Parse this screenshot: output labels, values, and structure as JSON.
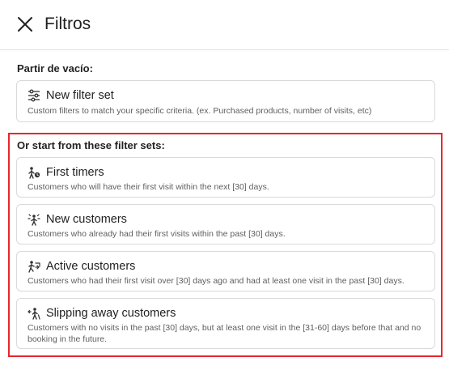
{
  "header": {
    "close_icon": "close-icon",
    "title": "Filtros"
  },
  "start_empty": {
    "label": "Partir de vacío:",
    "card": {
      "icon": "sliders-icon",
      "title": "New filter set",
      "description": "Custom filters to match your specific criteria. (ex. Purchased products, number of visits, etc)"
    }
  },
  "preset": {
    "label": "Or start from these filter sets:",
    "highlight_color": "#e8262c",
    "cards": [
      {
        "icon": "first-timer-icon",
        "title": "First timers",
        "description": "Customers who will have their first visit within the next [30] days."
      },
      {
        "icon": "new-customer-icon",
        "title": "New customers",
        "description": "Customers who already had their first visits within the past [30] days."
      },
      {
        "icon": "active-customer-icon",
        "title": "Active customers",
        "description": "Customers who had their first visit over [30] days ago and had at least one visit in the past [30] days."
      },
      {
        "icon": "slipping-away-icon",
        "title": "Slipping away customers",
        "description": "Customers with no visits in the past [30] days, but at least one visit in the [31-60] days before that and no booking in the future."
      }
    ]
  }
}
